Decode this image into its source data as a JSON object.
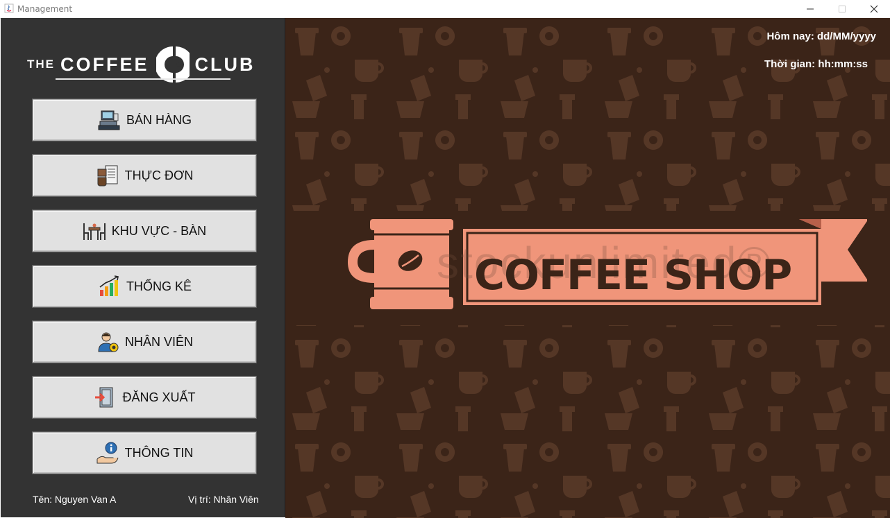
{
  "window": {
    "title": "Management",
    "controls": [
      "minimize",
      "maximize",
      "close"
    ]
  },
  "brand": {
    "the": "THE",
    "coffee": "COFFEE",
    "club": "CLUB"
  },
  "menu": [
    {
      "label": "BÁN HÀNG",
      "icon": "cash-register-icon"
    },
    {
      "label": "THỰC ĐƠN",
      "icon": "menu-board-icon"
    },
    {
      "label": "KHU VỰC - BÀN",
      "icon": "table-chairs-icon"
    },
    {
      "label": "THỐNG KÊ",
      "icon": "bar-chart-icon"
    },
    {
      "label": "NHÂN VIÊN",
      "icon": "staff-icon"
    },
    {
      "label": "ĐĂNG XUẤT",
      "icon": "logout-door-icon"
    },
    {
      "label": "THÔNG TIN",
      "icon": "info-hand-icon"
    }
  ],
  "user": {
    "name": "Tên: Nguyen Van A",
    "role": "Vị trí: Nhân Viên"
  },
  "header": {
    "today": "Hôm nay: dd/MM/yyyy",
    "clock": "Thời gian: hh:mm:ss"
  },
  "banner": {
    "text": "COFFEE SHOP",
    "watermark": "stockunlimited®"
  },
  "colors": {
    "sidebar": "#333333",
    "background": "#3b2418",
    "banner": "#f0957a",
    "button": "#e1e1e1"
  }
}
